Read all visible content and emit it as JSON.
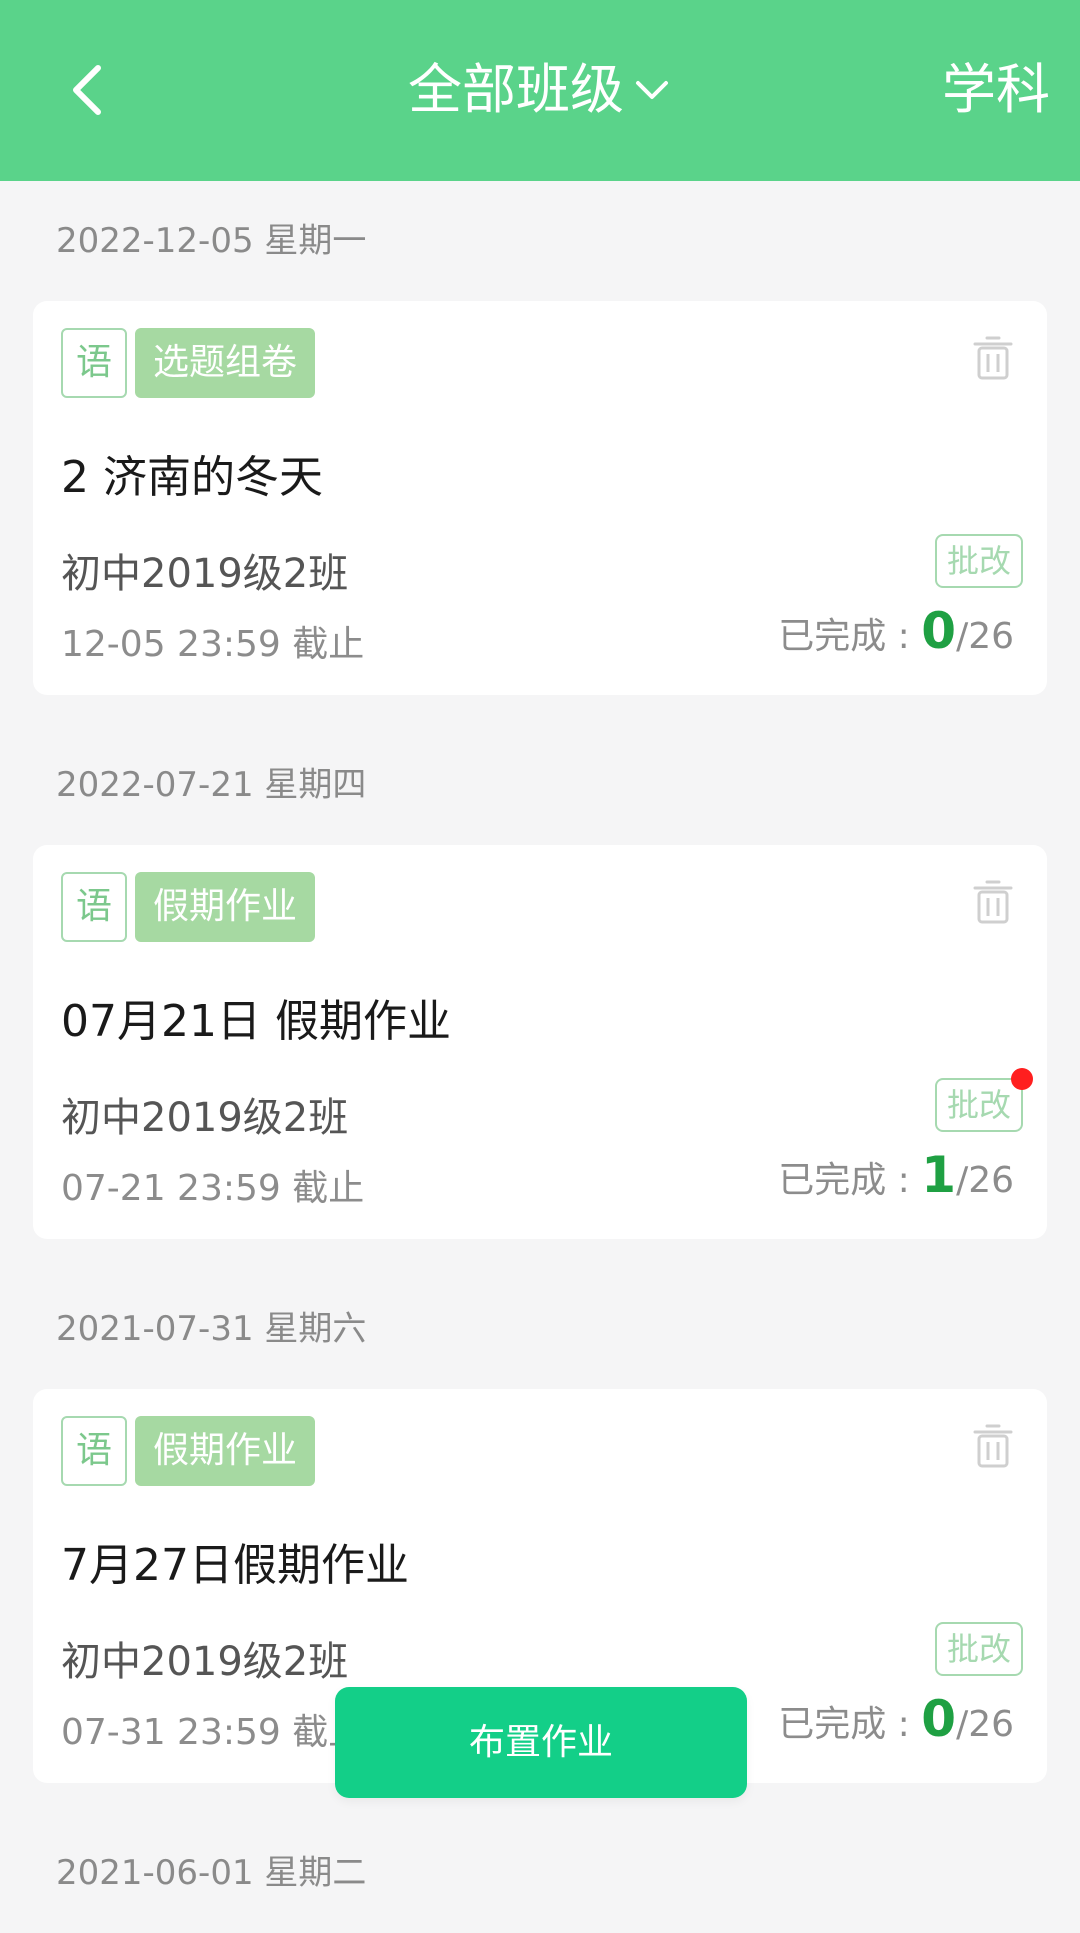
{
  "header": {
    "back_icon": "chevron-left-icon",
    "title": "全部班级",
    "dropdown_icon": "chevron-down-icon",
    "subject": "学科",
    "bg_color": "#5ad38a"
  },
  "groups": [
    {
      "date": "2022-12-05 星期一",
      "card": {
        "subject_badge": "语",
        "type_badge": "选题组卷",
        "title": "2 济南的冬天",
        "class_name": "初中2019级2班",
        "deadline": "12-05 23:59 截止",
        "grade_label": "批改",
        "has_notification": false,
        "completed_label": "已完成 :",
        "completed": "0",
        "total": "/26"
      }
    },
    {
      "date": "2022-07-21 星期四",
      "card": {
        "subject_badge": "语",
        "type_badge": "假期作业",
        "title": "07月21日 假期作业",
        "class_name": "初中2019级2班",
        "deadline": "07-21 23:59 截止",
        "grade_label": "批改",
        "has_notification": true,
        "completed_label": "已完成 :",
        "completed": "1",
        "total": "/26"
      }
    },
    {
      "date": "2021-07-31 星期六",
      "card": {
        "subject_badge": "语",
        "type_badge": "假期作业",
        "title": "7月27日假期作业",
        "class_name": "初中2019级2班",
        "deadline": "07-31 23:59 截止",
        "grade_label": "批改",
        "has_notification": false,
        "completed_label": "已完成 :",
        "completed": "0",
        "total": "/26"
      }
    },
    {
      "date": "2021-06-01 星期二"
    }
  ],
  "assign_button": "布置作业",
  "colors": {
    "accent_green": "#1fa043",
    "button_green": "#13cf88",
    "badge_green": "#a6d9a2",
    "notification_red": "#ff1f1f"
  }
}
